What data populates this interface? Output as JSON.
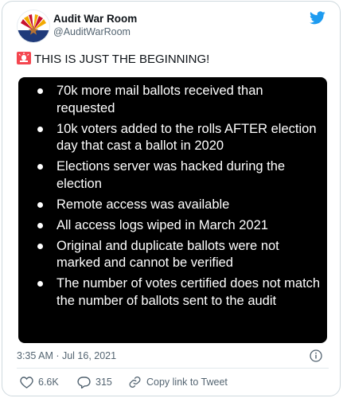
{
  "tweet": {
    "display_name": "Audit War Room",
    "handle": "@AuditWarRoom",
    "headline_text": "THIS IS JUST THE BEGINNING!",
    "headline_icon": "police-siren-emoji",
    "timestamp": "3:35 AM · Jul 16, 2021",
    "bullets": [
      "70k more mail ballots received than requested",
      "10k voters added to the rolls AFTER election day that cast a ballot in 2020",
      "Elections server was hacked during the election",
      "Remote access was available",
      "All access logs wiped in March 2021",
      "Original and duplicate ballots were not marked and cannot be verified",
      "The number of votes certified does not match the number of ballots sent to the audit"
    ],
    "actions": {
      "like_count": "6.6K",
      "reply_count": "315",
      "copy_link_label": "Copy link to Tweet"
    }
  },
  "icons": {
    "brand": "twitter-bird-icon",
    "like": "heart-icon",
    "reply": "speech-bubble-icon",
    "copy": "link-icon",
    "info": "info-icon"
  },
  "colors": {
    "twitter_blue": "#1d9bf0",
    "secondary_text": "#536471",
    "embed_background": "#000000",
    "arizona_red": "#c8102e",
    "arizona_gold": "#f2a900",
    "arizona_blue": "#1f3a7a"
  }
}
